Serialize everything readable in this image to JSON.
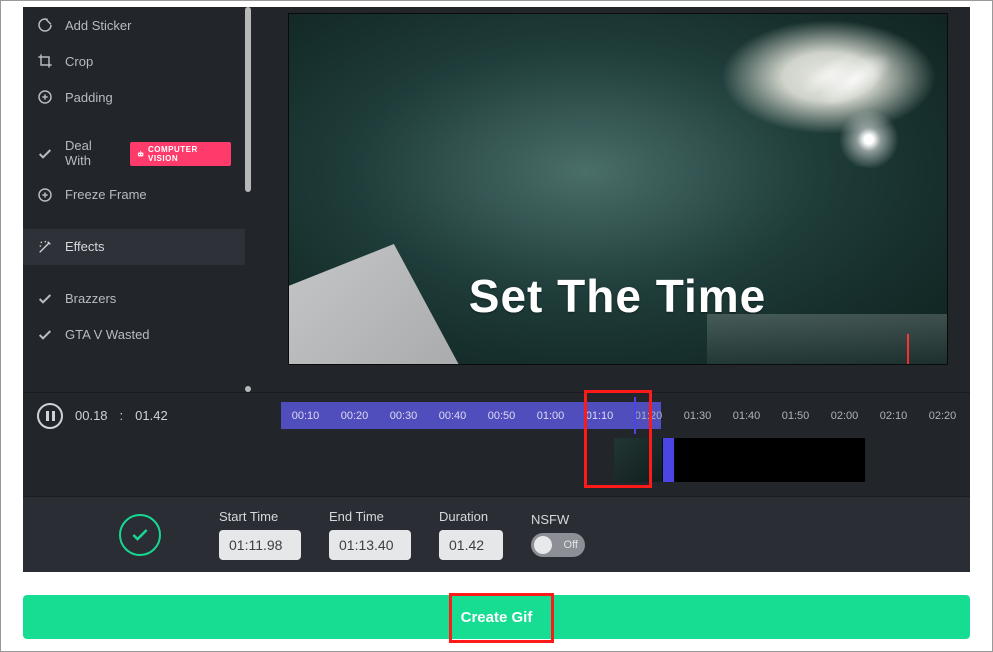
{
  "sidebar": {
    "items": [
      {
        "label": "Add Sticker",
        "icon": "sticker-icon"
      },
      {
        "label": "Crop",
        "icon": "crop-icon"
      },
      {
        "label": "Padding",
        "icon": "plus-circle-icon"
      }
    ],
    "deal_with_label": "Deal With",
    "deal_with_badge": "COMPUTER VISION",
    "freeze_label": "Freeze Frame",
    "effects_header": "Effects",
    "effects": [
      {
        "label": "Brazzers"
      },
      {
        "label": "GTA V Wasted"
      }
    ]
  },
  "overlay": {
    "title": "Set The Time"
  },
  "playback": {
    "current": "00.18",
    "sep": ":",
    "duration": "01.42"
  },
  "ruler": {
    "ticks": [
      "00:10",
      "00:20",
      "00:30",
      "00:40",
      "00:50",
      "01:00",
      "01:10",
      "01:20",
      "01:30",
      "01:40",
      "01:50",
      "02:00",
      "02:10",
      "02:20"
    ]
  },
  "controls": {
    "start_label": "Start Time",
    "start_value": "01:11.98",
    "end_label": "End Time",
    "end_value": "01:13.40",
    "duration_label": "Duration",
    "duration_value": "01.42",
    "nsfw_label": "NSFW",
    "nsfw_state": "Off"
  },
  "create_label": "Create Gif"
}
